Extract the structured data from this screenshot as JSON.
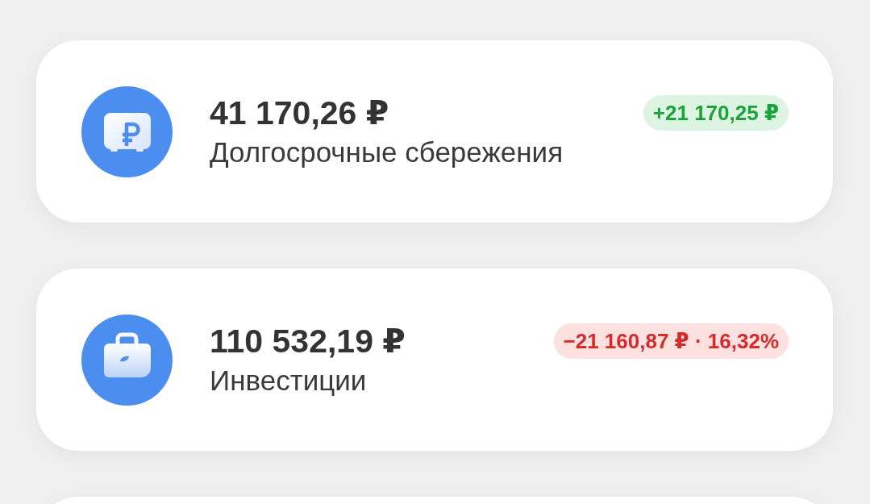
{
  "accounts": [
    {
      "kind": "savings",
      "amount": "41 170,26 ₽",
      "name": "Долгосрочные сбережения",
      "change": "+21 170,25 ₽",
      "positive": true
    },
    {
      "kind": "investment",
      "amount": "110 532,19 ₽",
      "name": "Инвестиции",
      "change": "−21 160,87 ₽ · 16,32%",
      "positive": false
    }
  ]
}
